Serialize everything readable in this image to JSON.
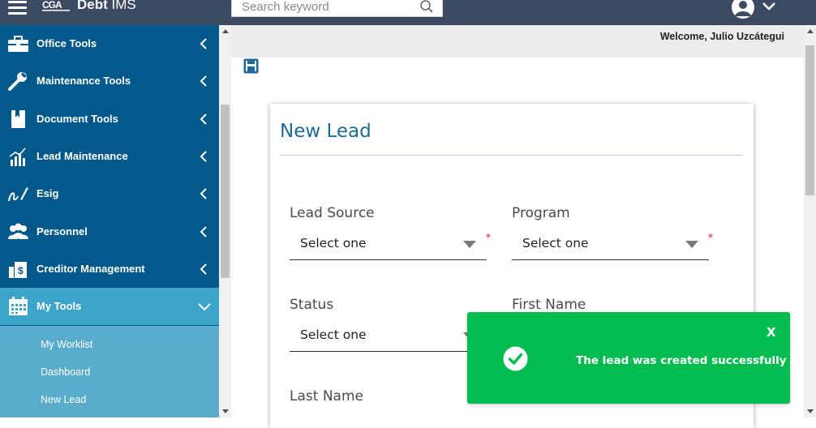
{
  "header": {
    "app_name_bold": "Debt",
    "app_name_rest": " IMS",
    "search_placeholder": "Search keyword"
  },
  "welcome": "Welcome, Julio Uzcátegui",
  "sidebar": {
    "items": [
      {
        "label": "Office Tools",
        "icon": "briefcase-icon"
      },
      {
        "label": "Maintenance Tools",
        "icon": "wrench-icon"
      },
      {
        "label": "Document Tools",
        "icon": "book-icon"
      },
      {
        "label": "Lead Maintenance",
        "icon": "bar-chart-icon"
      },
      {
        "label": "Esig",
        "icon": "signature-icon"
      },
      {
        "label": "Personnel",
        "icon": "people-icon"
      },
      {
        "label": "Creditor Management",
        "icon": "creditor-icon"
      },
      {
        "label": "My Tools",
        "icon": "calendar-icon"
      }
    ],
    "submenu": [
      "My Worklist",
      "Dashboard",
      "New Lead"
    ]
  },
  "form": {
    "title": "New Lead",
    "fields": {
      "lead_source": {
        "label": "Lead Source",
        "value": "Select one"
      },
      "program": {
        "label": "Program",
        "value": "Select one"
      },
      "status": {
        "label": "Status",
        "value": "Select one"
      },
      "first_name": {
        "label": "First Name"
      },
      "last_name": {
        "label": "Last Name"
      }
    },
    "required_mark": "*"
  },
  "toast": {
    "message": "The lead was created successfully",
    "close": "X"
  },
  "colors": {
    "topbar": "#3c4a62",
    "sidebar": "#00598a",
    "sidebar_active": "#3ba4c8",
    "submenu": "#5aaccc",
    "accent": "#1d6a9a",
    "toast": "#03bc4f",
    "required": "#e0245e"
  }
}
